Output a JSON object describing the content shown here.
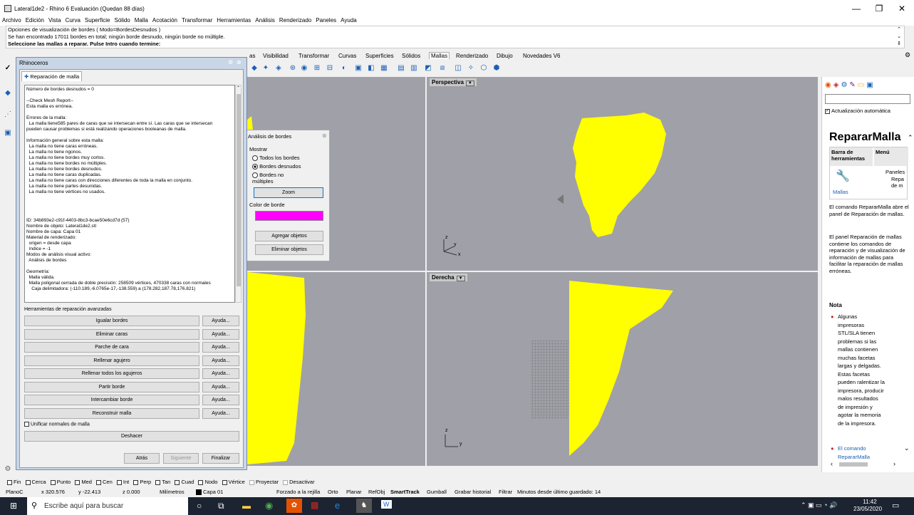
{
  "window": {
    "title": "Lateral1de2 - Rhino 6 Evaluación (Quedan 88 días)",
    "controls": {
      "minimize": "—",
      "maximize": "❐",
      "close": "✕"
    }
  },
  "menu": [
    "Archivo",
    "Edición",
    "Vista",
    "Curva",
    "Superficie",
    "Sólido",
    "Malla",
    "Acotación",
    "Transformar",
    "Herramientas",
    "Análisis",
    "Renderizado",
    "Paneles",
    "Ayuda"
  ],
  "command_history": [
    "Opciones de visualización de bordes ( Modo=BordesDesnudos )",
    "Se han encontrado 17011 bordes en total; ningún borde desnudo, ningún borde no múltiple.",
    "Seleccione las mallas a reparar. Pulse Intro cuando termine:"
  ],
  "toolbar_tabs": [
    "as",
    "Visibilidad",
    "Transformar",
    "Curvas",
    "Superficies",
    "Sólidos",
    "Mallas",
    "Renderizado",
    "Dibujo",
    "Novedades V6"
  ],
  "repair_window": {
    "title": "Rhinoceros",
    "panel_tab": "Reparación de malla",
    "report": "Número de bordes desnudos = 0\n\n--Check Mesh Report--\nEsta malla es errónea.\n\nErrores de la malla:\n  La malla tiene585 pares de caras que se intersecan entre sí. Las caras que se intersecan\npueden causar problemas si está realizando operaciones booleanas de malla.\n\nInformación general sobre esta malla:\n  La malla no tiene caras erróneas.\n  La malla no tiene ngonos.\n  La malla no tiene bordes muy cortos.\n  La malla no tiene bordes no múltiples.\n  La malla no tiene bordes desnudos.\n  La malla no tiene caras duplicadas.\n  La malla no tiene caras con direcciones diferentes de toda la malla en conjunto.\n  La malla no tiene partes desunidas.\n  La malla no tiene vértices no usados.\n\n\n\n\nID: 34b893e2-c91f-4403-8bc3-bcae50e6cd7d (57)\nNombre de objeto: Lateral1de2.stl\nNombre de capa: Capa 01\nMaterial de renderizado:\n  origen = desde capa\n  índice = -1\nModos de análisis visual activo:\n  Análisis de bordes\n\nGeometría:\n  Malla válida.\n  Malla poligonal cerrada de doble precisión: 258509 vértices, 470338 caras con normales\n    Caja delimitadora: (-110.189,-6.0765e-17,-138.559) a (178.282,187.78,176.821)",
    "tools_label": "Herramientas de reparación avanzadas",
    "tools": [
      "Igualar bordes",
      "Eliminar caras",
      "Parche de cara",
      "Rellenar agujero",
      "Rellenar todos los agujeros",
      "Partir borde",
      "Intercambiar borde",
      "Reconstruir malla"
    ],
    "help_label": "Ayuda...",
    "unify_normals": "Unificar normales de malla",
    "undo": "Deshacer",
    "back": "Atrás",
    "next": "Siguiente",
    "finish": "Finalizar"
  },
  "edge_dialog": {
    "title": "Análisis de bordes",
    "show_label": "Mostrar",
    "options": [
      "Todos los bordes",
      "Bordes desnudos",
      "Bordes no múltiples"
    ],
    "selected_option": 1,
    "zoom": "Zoom",
    "color_label": "Color de borde",
    "edge_color": "#ff00ff",
    "add_objects": "Agregar objetos",
    "remove_objects": "Eliminar objetos"
  },
  "viewports": {
    "perspective": "Perspectiva",
    "right": "Derecha",
    "axis_x": "x",
    "axis_y": "y",
    "axis_z": "z",
    "mesh_color": "#ffff00"
  },
  "right_panel": {
    "auto_update": "Actualización automática",
    "heading": "RepararMalla",
    "table_col1": "Barra de herramientas",
    "table_col2": "Menú",
    "table_cell1": "Mallas",
    "table_cell2a": "Paneles",
    "table_cell2b": "Repa de m",
    "desc1": "El comando RepararMalla abre el panel de Reparación de mallas.",
    "desc2": "El panel Reparación de mallas contiene los comandos de reparación y de visualización de información de mallas para facilitar la reparación de mallas erróneas.",
    "note_heading": "Nota",
    "note1": "Algunas impresoras STL/SLA tienen problemas si las mallas contienen muchas facetas largas y delgadas. Estas facetas pueden ralentizar la impresora, producir malos resultados de impresión y agotar la memoria de la impresora.",
    "note2": "El comando RepararMalla"
  },
  "osnaps": [
    "Fin",
    "Cerca",
    "Punto",
    "Med",
    "Cen",
    "Int",
    "Perp",
    "Tan",
    "Cuad",
    "Nodo",
    "Vértice",
    "Proyectar",
    "Desactivar"
  ],
  "status": {
    "plane": "PlanoC",
    "x": "x 320.576",
    "y": "y -22.413",
    "z": "z 0.000",
    "units": "Milímetros",
    "layer": "Capa 01",
    "items": [
      "Forzado a la rejilla",
      "Orto",
      "Planar",
      "RefObj",
      "SmartTrack",
      "Gumball",
      "Grabar historial",
      "Filtrar"
    ],
    "autosave": "Minutos desde último guardado: 14"
  },
  "taskbar": {
    "search": "Escribe aquí para buscar",
    "time": "11:42",
    "date": "23/05/2020"
  }
}
